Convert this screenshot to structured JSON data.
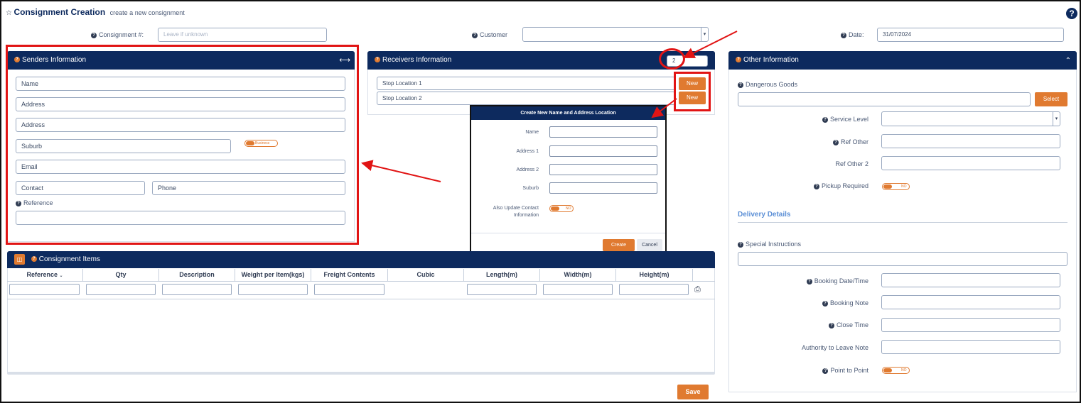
{
  "header": {
    "title": "Consignment Creation",
    "subtitle": "create a new consignment",
    "consignment_label": "Consignment #:",
    "consignment_placeholder": "Leave if unknown",
    "customer_label": "Customer",
    "date_label": "Date:",
    "date_value": "31/07/2024"
  },
  "senders": {
    "title": "Senders Information",
    "name": "Name",
    "address1": "Address",
    "address2": "Address",
    "suburb": "Suburb",
    "business_toggle": "Business",
    "email": "Email",
    "contact": "Contact",
    "phone": "Phone",
    "reference_label": "Reference"
  },
  "receivers": {
    "title": "Receivers Information",
    "count": "2",
    "stops": [
      "Stop Location 1",
      "Stop Location 2"
    ],
    "new_label": "New"
  },
  "dialog": {
    "title": "Create New Name and Address Location",
    "name_label": "Name",
    "address1_label": "Address 1",
    "address2_label": "Address 2",
    "suburb_label": "Suburb",
    "update_label_1": "Also Update Contact",
    "update_label_2": "Information",
    "update_toggle": "NO",
    "create": "Create",
    "cancel": "Cancel"
  },
  "other": {
    "title": "Other Information",
    "dangerous_goods": "Dangerous Goods",
    "select": "Select",
    "service_level": "Service Level",
    "ref_other": "Ref Other",
    "ref_other2": "Ref Other 2",
    "pickup_required": "Pickup Required",
    "pickup_toggle": "NO",
    "delivery_details": "Delivery Details",
    "special_instructions": "Special Instructions",
    "booking_datetime": "Booking Date/Time",
    "booking_note": "Booking Note",
    "close_time": "Close Time",
    "authority_note": "Authority to Leave Note",
    "point_to_point": "Point to Point",
    "p2p_toggle": "NO"
  },
  "items": {
    "title": "Consignment Items",
    "columns": [
      "Reference",
      "Qty",
      "Description",
      "Weight per Item(kgs)",
      "Freight Contents",
      "Cubic",
      "Length(m)",
      "Width(m)",
      "Height(m)"
    ]
  },
  "footer": {
    "save": "Save"
  },
  "colors": {
    "header_navy": "#0d2a5e",
    "accent_orange": "#e07a30",
    "annotation_red": "#e11414"
  }
}
